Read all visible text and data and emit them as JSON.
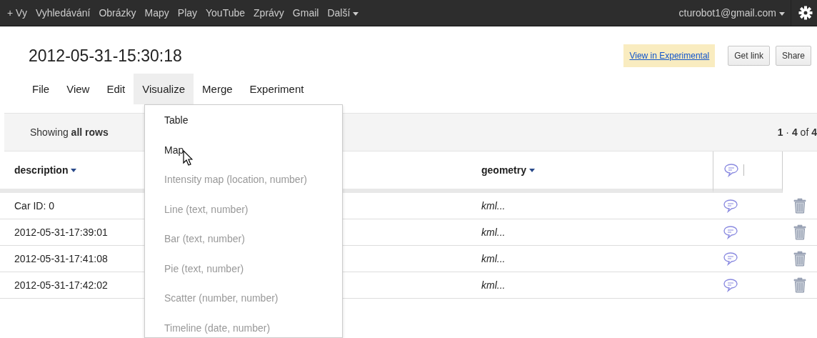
{
  "topbar": {
    "links": [
      "+ Vy",
      "Vyhledávání",
      "Obrázky",
      "Mapy",
      "Play",
      "YouTube",
      "Zprávy",
      "Gmail"
    ],
    "more": "Další",
    "account": "cturobot1@gmail.com"
  },
  "title": "2012-05-31-15:30:18",
  "actions": [
    {
      "label": "View in Experimental",
      "kind": "link"
    },
    {
      "label": "Get link",
      "kind": "button"
    },
    {
      "label": "Share",
      "kind": "button"
    }
  ],
  "menubar": [
    {
      "label": "File",
      "selected": false
    },
    {
      "label": "View",
      "selected": false
    },
    {
      "label": "Edit",
      "selected": false
    },
    {
      "label": "Visualize",
      "selected": true
    },
    {
      "label": "Merge",
      "selected": false
    },
    {
      "label": "Experiment",
      "selected": false
    }
  ],
  "dropdown": [
    {
      "label": "Table",
      "disabled": false
    },
    {
      "label": "Map",
      "disabled": false
    },
    {
      "label": "Intensity map (location, number)",
      "disabled": true
    },
    {
      "label": "Line (text, number)",
      "disabled": true
    },
    {
      "label": "Bar (text, number)",
      "disabled": true
    },
    {
      "label": "Pie (text, number)",
      "disabled": true
    },
    {
      "label": "Scatter (number, number)",
      "disabled": true
    },
    {
      "label": "Timeline (date, number)",
      "disabled": true
    }
  ],
  "toolbar": {
    "showing": "Showing **all rows**",
    "range": "**1** · **4** of **4**"
  },
  "table": {
    "columns": [
      "description",
      "geometry"
    ],
    "rows": [
      [
        "Car ID: 0",
        "kml..."
      ],
      [
        "2012-05-31-17:39:01",
        "kml..."
      ],
      [
        "2012-05-31-17:41:08",
        "kml..."
      ],
      [
        "2012-05-31-17:42:02",
        "kml..."
      ]
    ]
  }
}
